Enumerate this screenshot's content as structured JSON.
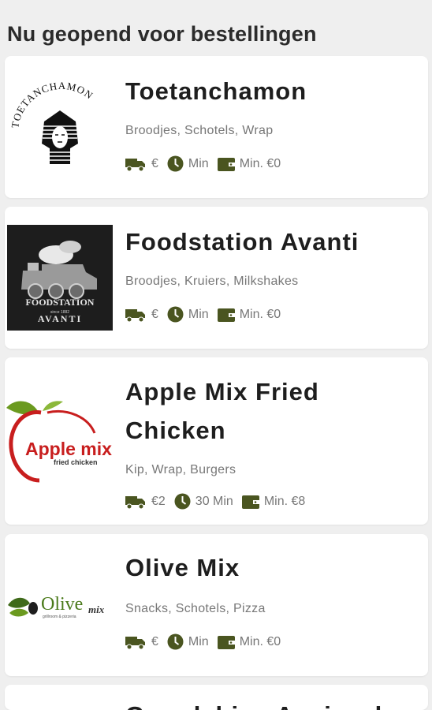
{
  "section_title": "Nu geopend voor bestellingen",
  "colors": {
    "icon": "#4a5520",
    "background": "#efefef"
  },
  "restaurants": [
    {
      "name": "Toetanchamon",
      "cuisine": "Broodjes, Schotels, Wrap",
      "delivery_fee": "€",
      "delivery_time": "Min",
      "min_order": "Min. €0",
      "logo": "pharaoh-logo",
      "logo_text": "TOETANCHAMON"
    },
    {
      "name": "Foodstation Avanti",
      "cuisine": "Broodjes, Kruiers, Milkshakes",
      "delivery_fee": "€",
      "delivery_time": "Min",
      "min_order": "Min. €0",
      "logo": "train-logo",
      "logo_text": "FOODSTATION",
      "logo_subtext": "since 1882",
      "logo_text2": "AVANTI"
    },
    {
      "name": "Apple Mix Fried Chicken",
      "cuisine": "Kip, Wrap, Burgers",
      "delivery_fee": "€2",
      "delivery_time": "30 Min",
      "min_order": "Min. €8",
      "logo": "apple-logo",
      "logo_text": "Apple mix",
      "logo_subtext": "fried chicken"
    },
    {
      "name": "Olive Mix",
      "cuisine": "Snacks, Schotels, Pizza",
      "delivery_fee": "€",
      "delivery_time": "Min",
      "min_order": "Min. €0",
      "logo": "olive-logo",
      "logo_text": "Olive",
      "logo_text2": "mix",
      "logo_subtext": "grillroom & pizzeria"
    }
  ],
  "partial_card_title": "Grandchien Aaniavals"
}
